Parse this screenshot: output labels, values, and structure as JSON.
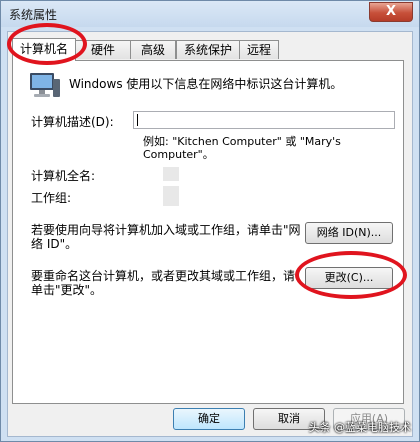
{
  "window": {
    "title": "系统属性",
    "close_glyph": "X"
  },
  "tabs": [
    {
      "label": "计算机名"
    },
    {
      "label": "硬件"
    },
    {
      "label": "高级"
    },
    {
      "label": "系统保护"
    },
    {
      "label": "远程"
    }
  ],
  "panel": {
    "intro": "Windows 使用以下信息在网络中标识这台计算机。",
    "description_label": "计算机描述(D):",
    "description_value": "",
    "example_text": "例如: \"Kitchen Computer\" 或 \"Mary's Computer\"。",
    "full_name_label": "计算机全名:",
    "workgroup_label": "工作组:",
    "network_text": "若要使用向导将计算机加入域或工作组，请单击\"网络 ID\"。",
    "network_button": "网络 ID(N)...",
    "rename_text": "要重命名这台计算机，或者更改其域或工作组，请单击\"更改\"。",
    "change_button": "更改(C)..."
  },
  "footer": {
    "ok": "确定",
    "cancel": "取消",
    "apply": "应用(A)"
  },
  "icons": {
    "computer": "computer-icon"
  },
  "colors": {
    "highlight": "#e0141e"
  },
  "watermark": "头条 @蓝菜电脑技术"
}
